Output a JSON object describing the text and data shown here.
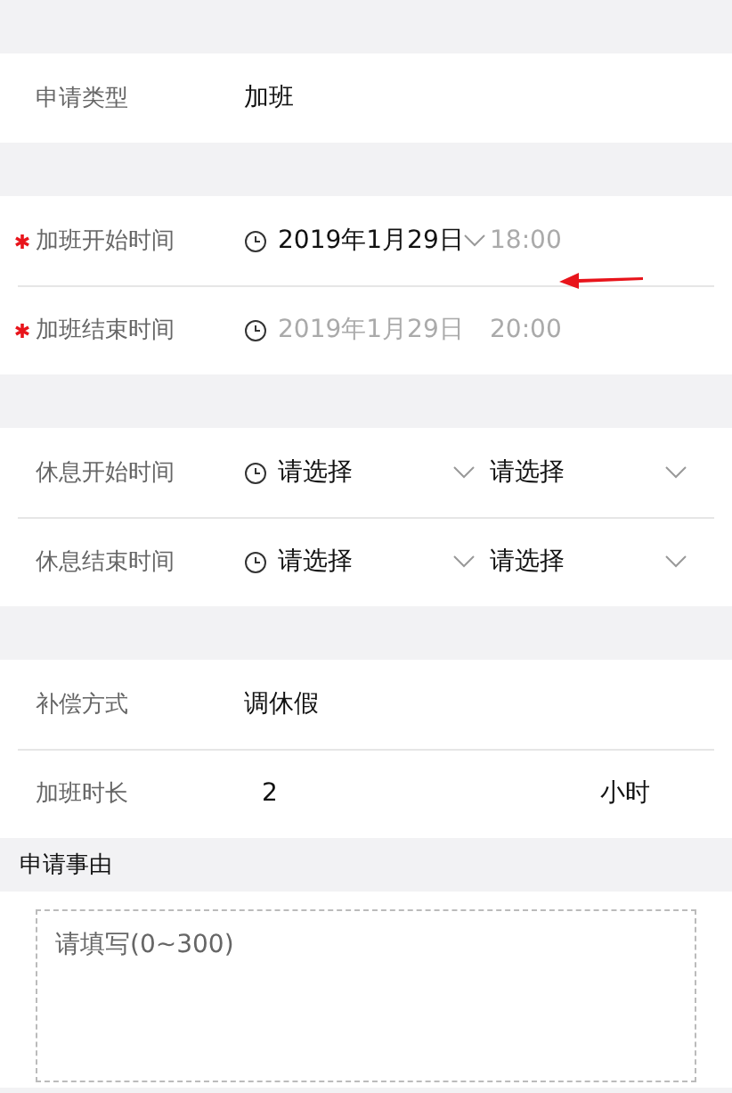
{
  "sections": [
    {
      "rows": [
        {
          "kind": "text",
          "label": "申请类型",
          "value": "加班"
        }
      ]
    },
    {
      "rows": [
        {
          "kind": "datetime",
          "required": true,
          "label": "加班开始时间",
          "date": {
            "text": "2019年1月29日",
            "dimmed": false,
            "dropdown": true
          },
          "time": {
            "text": "18:00",
            "dimmed": true,
            "dropdown": false
          }
        },
        {
          "kind": "datetime",
          "required": true,
          "label": "加班结束时间",
          "date": {
            "text": "2019年1月29日",
            "dimmed": true,
            "dropdown": false
          },
          "time": {
            "text": "20:00",
            "dimmed": true,
            "dropdown": false
          }
        }
      ]
    },
    {
      "rows": [
        {
          "kind": "datetime",
          "required": false,
          "label": "休息开始时间",
          "date": {
            "text": "请选择",
            "dimmed": false,
            "dropdown": true
          },
          "time": {
            "text": "请选择",
            "dimmed": false,
            "dropdown": true
          }
        },
        {
          "kind": "datetime",
          "required": false,
          "label": "休息结束时间",
          "date": {
            "text": "请选择",
            "dimmed": false,
            "dropdown": true
          },
          "time": {
            "text": "请选择",
            "dimmed": false,
            "dropdown": true
          }
        }
      ]
    },
    {
      "rows": [
        {
          "kind": "text",
          "label": "补偿方式",
          "value": "调休假"
        },
        {
          "kind": "number",
          "label": "加班时长",
          "value": "2",
          "unit": "小时"
        }
      ]
    }
  ],
  "reason": {
    "title": "申请事由",
    "placeholder": "请填写(0~300)"
  }
}
